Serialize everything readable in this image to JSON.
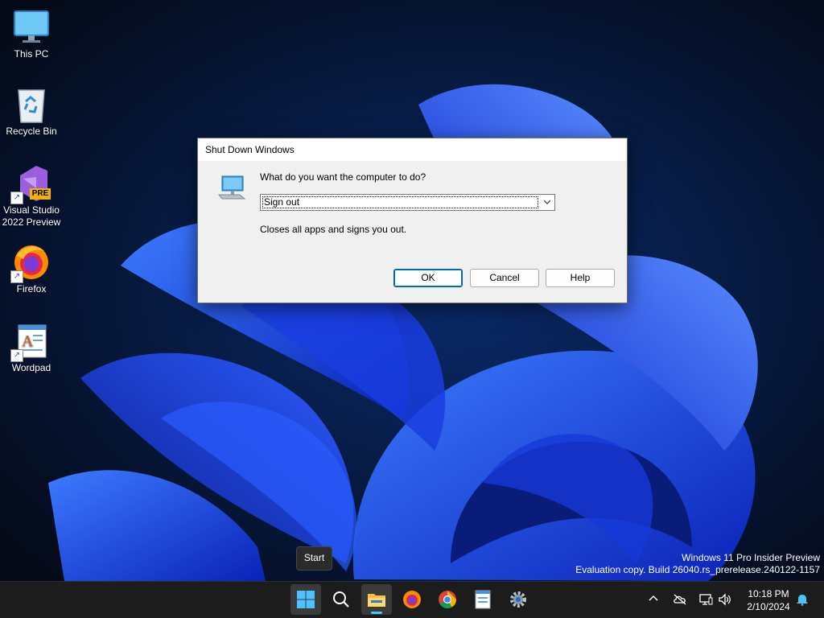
{
  "desktop": {
    "icons": [
      {
        "label": "This PC",
        "icon": "monitor-icon",
        "shortcut": false
      },
      {
        "label": "Recycle Bin",
        "icon": "recycle-bin-icon",
        "shortcut": false
      },
      {
        "label": "Visual Studio 2022 Preview",
        "icon": "visual-studio-icon",
        "badge": "PRE",
        "shortcut": true
      },
      {
        "label": "Firefox",
        "icon": "firefox-icon",
        "shortcut": true
      },
      {
        "label": "Wordpad",
        "icon": "wordpad-icon",
        "shortcut": true
      }
    ],
    "shortcut_arrow": "↗"
  },
  "dialog": {
    "title": "Shut Down Windows",
    "question": "What do you want the computer to do?",
    "selected_option": "Sign out",
    "description": "Closes all apps and signs you out.",
    "buttons": {
      "ok": "OK",
      "cancel": "Cancel",
      "help": "Help"
    }
  },
  "watermark": {
    "line1": "Windows 11 Pro Insider Preview",
    "line2": "Evaluation copy. Build 26040.rs_prerelease.240122-1157"
  },
  "tooltip": {
    "start": "Start"
  },
  "taskbar": {
    "apps": [
      "start-icon",
      "search-icon",
      "file-explorer-icon",
      "firefox-icon",
      "chrome-icon",
      "wordpad-icon",
      "settings-icon"
    ],
    "tray": [
      "chevron-up-icon",
      "onedrive-icon",
      "network-icon",
      "volume-icon"
    ],
    "clock": {
      "time": "10:18 PM",
      "date": "2/10/2024"
    },
    "notification": "bell-icon"
  },
  "colors": {
    "wallpaper_bg": "#050d1f",
    "bloom_blue": "#1f4cf0",
    "accent": "#0067c0",
    "taskbar_bg": "#1c1c1c"
  }
}
